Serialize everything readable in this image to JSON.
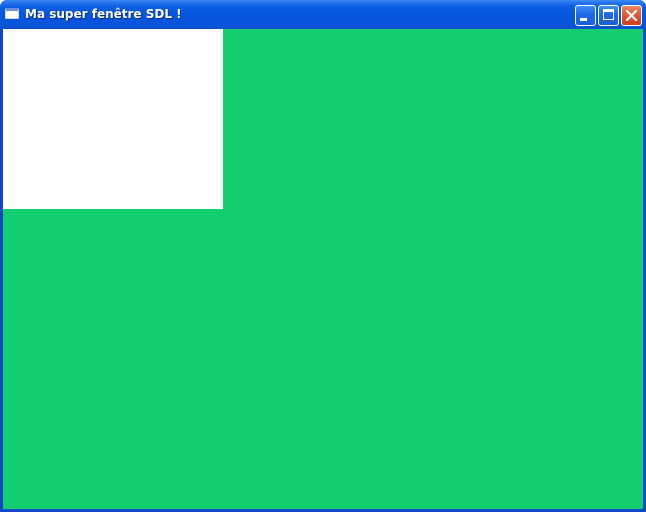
{
  "window": {
    "title": "Ma super fenêtre SDL !",
    "icon": "window-app-icon",
    "controls": {
      "minimize_icon": "minimize-icon",
      "maximize_icon": "maximize-icon",
      "close_icon": "close-icon"
    }
  },
  "colors": {
    "titlebar": "#0558de",
    "client_background": "#12ce70",
    "rectangle": "#ffffff",
    "close_button": "#dd5a35"
  }
}
